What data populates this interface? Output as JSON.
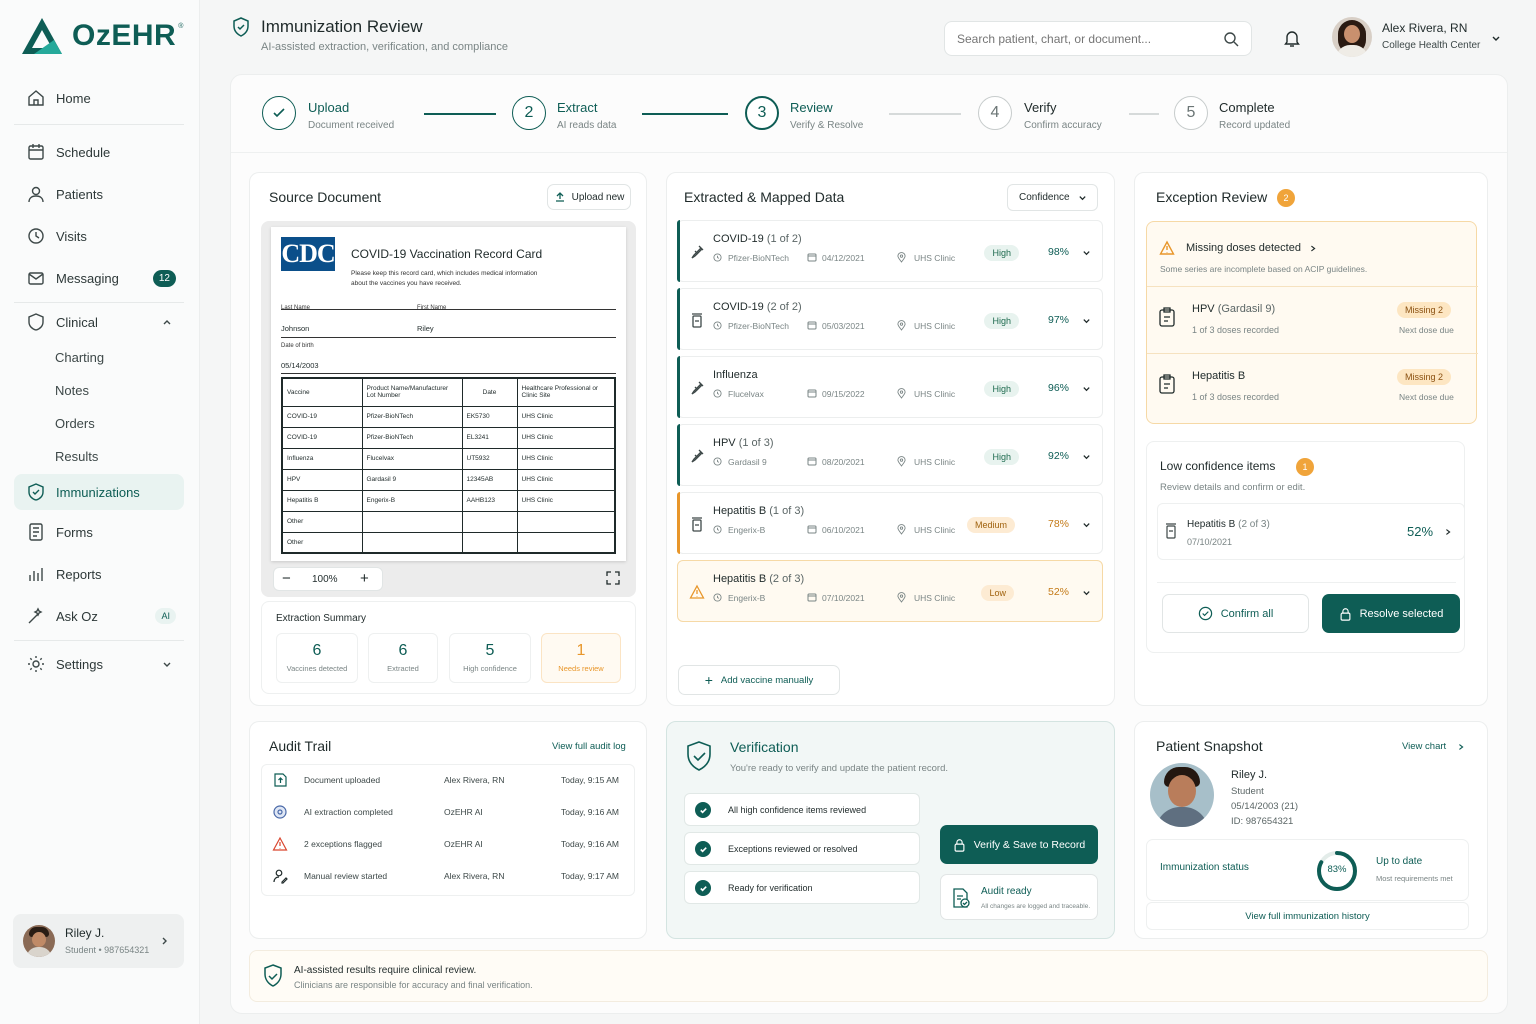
{
  "brand": {
    "name": "OzEHR",
    "tm": "®"
  },
  "sidebar": {
    "items": [
      {
        "label": "Home",
        "icon": "home-icon"
      },
      {
        "label": "Schedule",
        "icon": "calendar-icon"
      },
      {
        "label": "Patients",
        "icon": "user-icon"
      },
      {
        "label": "Visits",
        "icon": "clock-icon"
      },
      {
        "label": "Messaging",
        "icon": "mail-icon",
        "badge": "12"
      },
      {
        "label": "Clinical",
        "icon": "shield-icon"
      },
      {
        "label": "Immunizations",
        "icon": "shield-check-icon"
      },
      {
        "label": "Forms",
        "icon": "form-icon"
      },
      {
        "label": "Reports",
        "icon": "bar-chart-icon"
      },
      {
        "label": "Ask Oz",
        "icon": "wand-icon",
        "badge": "AI"
      },
      {
        "label": "Settings",
        "icon": "gear-icon"
      }
    ],
    "clinical_sub": [
      "Charting",
      "Notes",
      "Orders",
      "Results"
    ],
    "user": {
      "name": "Riley J.",
      "sub": "Student • 987654321"
    }
  },
  "header": {
    "title": "Immunization Review",
    "subtitle": "AI-assisted extraction, verification, and compliance",
    "search_placeholder": "Search patient, chart, or document...",
    "user_name": "Alex Rivera, RN",
    "user_org": "College Health Center"
  },
  "steps": [
    {
      "num": "1",
      "title": "Upload",
      "sub": "Document received",
      "state": "done"
    },
    {
      "num": "2",
      "title": "Extract",
      "sub": "AI reads data",
      "state": "done"
    },
    {
      "num": "3",
      "title": "Review",
      "sub": "Verify & Resolve",
      "state": "active"
    },
    {
      "num": "4",
      "title": "Verify",
      "sub": "Confirm accuracy",
      "state": "todo"
    },
    {
      "num": "5",
      "title": "Complete",
      "sub": "Record updated",
      "state": "todo"
    }
  ],
  "source": {
    "title": "Source Document",
    "upload_btn": "Upload new",
    "doc": {
      "logo": "CDC",
      "title": "COVID-19 Vaccination Record Card",
      "note": "Please keep this record card, which includes medical information about the vaccines you have received.",
      "last_name_label": "Last Name",
      "last_name": "Johnson",
      "first_name_label": "First Name",
      "first_name": "Riley",
      "dob_label": "Date of birth",
      "dob": "05/14/2003",
      "columns": [
        "Vaccine",
        "Product Name/Manufacturer Lot Number",
        "Date",
        "Healthcare Professional or Clinic Site"
      ],
      "rows": [
        [
          "COVID-19",
          "Pfizer-BioNTech",
          "EK5730",
          "UHS Clinic"
        ],
        [
          "COVID-19",
          "Pfizer-BioNTech",
          "EL3241",
          "UHS Clinic"
        ],
        [
          "Influenza",
          "Flucelvax",
          "UT5932",
          "UHS Clinic"
        ],
        [
          "HPV",
          "Gardasil 9",
          "12345AB",
          "UHS Clinic"
        ],
        [
          "Hepatitis B",
          "Engerix-B",
          "AAHB123",
          "UHS Clinic"
        ],
        [
          "Other",
          "",
          "",
          ""
        ],
        [
          "Other",
          "",
          "",
          ""
        ]
      ]
    },
    "zoom": "100%",
    "summary_title": "Extraction Summary",
    "summary": [
      {
        "value": "6",
        "label": "Vaccines detected"
      },
      {
        "value": "6",
        "label": "Extracted"
      },
      {
        "value": "5",
        "label": "High confidence"
      },
      {
        "value": "1",
        "label": "Needs review"
      }
    ]
  },
  "extracted": {
    "title": "Extracted & Mapped Data",
    "filter": "Confidence",
    "rows": [
      {
        "name": "COVID-19",
        "dose": "(1 of 2)",
        "maker": "Pfizer-BioNTech",
        "date": "04/12/2021",
        "site": "UHS Clinic",
        "level": "High",
        "pct": "98%",
        "kind": "high",
        "icon": "syringe-icon"
      },
      {
        "name": "COVID-19",
        "dose": "(2 of 2)",
        "maker": "Pfizer-BioNTech",
        "date": "05/03/2021",
        "site": "UHS Clinic",
        "level": "High",
        "pct": "97%",
        "kind": "high",
        "icon": "vial-icon"
      },
      {
        "name": "Influenza",
        "dose": "",
        "maker": "Flucelvax",
        "date": "09/15/2022",
        "site": "UHS Clinic",
        "level": "High",
        "pct": "96%",
        "kind": "high",
        "icon": "syringe-icon"
      },
      {
        "name": "HPV",
        "dose": "(1 of 3)",
        "maker": "Gardasil 9",
        "date": "08/20/2021",
        "site": "UHS Clinic",
        "level": "High",
        "pct": "92%",
        "kind": "high",
        "icon": "syringe-icon"
      },
      {
        "name": "Hepatitis B",
        "dose": "(1 of 3)",
        "maker": "Engerix-B",
        "date": "06/10/2021",
        "site": "UHS Clinic",
        "level": "Medium",
        "pct": "78%",
        "kind": "med",
        "icon": "vial-icon"
      },
      {
        "name": "Hepatitis B",
        "dose": "(2 of 3)",
        "maker": "Engerix-B",
        "date": "07/10/2021",
        "site": "UHS Clinic",
        "level": "Low",
        "pct": "52%",
        "kind": "low",
        "icon": "warning-icon"
      }
    ],
    "add_btn": "Add vaccine manually"
  },
  "exceptions": {
    "title": "Exception Review",
    "count": "2",
    "alert_title": "Missing doses detected",
    "alert_sub": "Some series are incomplete based on ACIP guidelines.",
    "items": [
      {
        "name": "HPV",
        "paren": "(Gardasil 9)",
        "sub": "1 of 3 doses recorded",
        "badge": "Missing 2",
        "due": "Next dose due"
      },
      {
        "name": "Hepatitis B",
        "paren": "",
        "sub": "1 of 3 doses recorded",
        "badge": "Missing 2",
        "due": "Next dose due"
      }
    ],
    "low_title": "Low confidence items",
    "low_count": "1",
    "low_sub": "Review details and confirm or edit.",
    "low_item": {
      "name": "Hepatitis B",
      "paren": "(2 of 3)",
      "date": "07/10/2021",
      "pct": "52%"
    },
    "confirm_btn": "Confirm all",
    "resolve_btn": "Resolve selected"
  },
  "audit": {
    "title": "Audit Trail",
    "link": "View full audit log",
    "rows": [
      {
        "event": "Document uploaded",
        "who": "Alex Rivera, RN",
        "when": "Today, 9:15 AM",
        "icon": "upload-doc-icon"
      },
      {
        "event": "AI extraction completed",
        "who": "OzEHR AI",
        "when": "Today, 9:16 AM",
        "icon": "ai-icon"
      },
      {
        "event": "2 exceptions flagged",
        "who": "OzEHR AI",
        "when": "Today, 9:16 AM",
        "icon": "warning-icon"
      },
      {
        "event": "Manual review started",
        "who": "Alex Rivera, RN",
        "when": "Today, 9:17 AM",
        "icon": "user-edit-icon"
      }
    ]
  },
  "verification": {
    "title": "Verification",
    "sub": "You're ready to verify and update the patient record.",
    "checks": [
      "All high confidence items reviewed",
      "Exceptions reviewed or resolved",
      "Ready for verification"
    ],
    "verify_btn": "Verify & Save to Record",
    "audit_ready": "Audit ready",
    "audit_ready_sub": "All changes are logged and traceable."
  },
  "snapshot": {
    "title": "Patient Snapshot",
    "link": "View chart",
    "name": "Riley J.",
    "role": "Student",
    "dob": "05/14/2003 (21)",
    "id": "ID: 987654321",
    "status_label": "Immunization status",
    "pct": "83%",
    "pct_value": 0.83,
    "status": "Up to date",
    "status_sub": "Most requirements met",
    "history_link": "View full immunization history"
  },
  "footer": {
    "title": "AI-assisted results require clinical review.",
    "sub": "Clinicians are responsible for accuracy and final verification."
  },
  "colors": {
    "brand": "#0e5d55",
    "warning": "#e8962a",
    "danger": "#d9462f"
  }
}
